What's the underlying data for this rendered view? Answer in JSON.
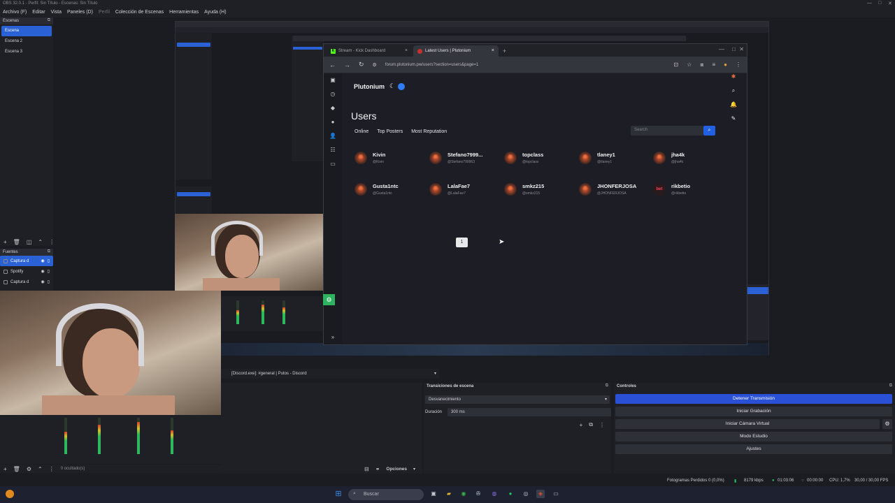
{
  "obs": {
    "title": "OBS 32.0.1 - Perfil: Sin Título - Escenas: Sin Título",
    "menu": [
      "Archivo (F)",
      "Editar",
      "Vista",
      "Paneles (D)",
      "Perfil",
      "Colección de Escenas",
      "Herramientas",
      "Ayuda (H)"
    ],
    "scenes_label": "Escenas",
    "scenes": [
      "Escena",
      "Escena 2",
      "Escena 3"
    ],
    "sources_label": "Fuentes",
    "sources": [
      "Captura d",
      "Spotify",
      "Captura d"
    ],
    "source_select": "[Discord.exe]: #general | Putos - Discord",
    "hidden_count": "0 ocultado(s)",
    "options_label": "Opciones",
    "transitions": {
      "title": "Transiciones de escena",
      "type": "Desvanecimiento",
      "duration_label": "Duración",
      "duration": "300 ms"
    },
    "controls": {
      "title": "Controles",
      "buttons": [
        "Detener Transmisión",
        "Iniciar Grabación",
        "Iniciar Cámara Virtual",
        "Modo Estudio",
        "Ajustes"
      ]
    },
    "status": {
      "dropped": "Fotogramas Perdidos 0 (0,0%)",
      "bitrate": "8179 kbps",
      "stream_time": "01:03:06",
      "rec_time": "00:00:00",
      "cpu": "CPU: 1,7%",
      "fps": "30,00 / 30,00 FPS"
    }
  },
  "browser": {
    "tabs": [
      {
        "label": "Stream - Kick Dashboard"
      },
      {
        "label": "Latest Users | Plutonium"
      }
    ],
    "url": "forum.plutonium.pw/users?section=users&page=1",
    "brand": "Plutonium",
    "page_title": "Users",
    "nav": [
      "Online",
      "Top Posters",
      "Most Reputation"
    ],
    "search_placeholder": "Search",
    "users": [
      {
        "name": "Kivin",
        "handle": "@Kivin"
      },
      {
        "name": "Stefano7999...",
        "handle": "@Stefano799963"
      },
      {
        "name": "topclass",
        "handle": "@topclass"
      },
      {
        "name": "tlaney1",
        "handle": "@tlaney1"
      },
      {
        "name": "jha4k",
        "handle": "@jha4k"
      },
      {
        "name": "Gusta1ntc",
        "handle": "@Gusta1ntc"
      },
      {
        "name": "LalaFae7",
        "handle": "@LalaFae7"
      },
      {
        "name": "smkz215",
        "handle": "@smkz215"
      },
      {
        "name": "JHONFERJOSA",
        "handle": "@JHONFERJOSA"
      },
      {
        "name": "rikbetio",
        "handle": "@rikbetio"
      }
    ],
    "current_page": "1"
  },
  "taskbar": {
    "search": "Buscar"
  },
  "colors": {
    "accent": "#2a50d6",
    "selected": "#2a62d6",
    "plutonium_blue": "#2160e0"
  }
}
